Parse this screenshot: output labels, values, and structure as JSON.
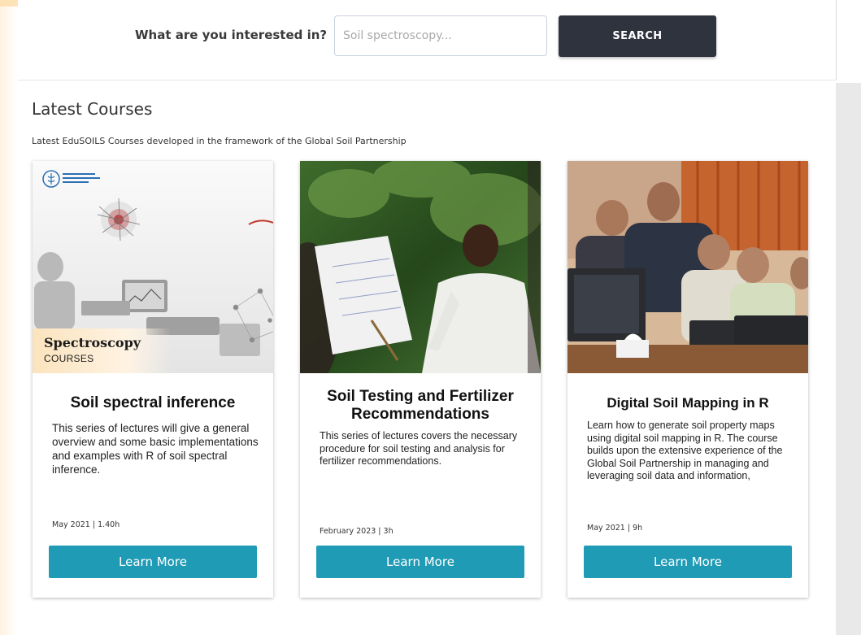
{
  "search": {
    "label": "What are you interested in?",
    "placeholder": "Soil spectroscopy...",
    "button_label": "SEARCH"
  },
  "section": {
    "title": "Latest Courses",
    "subtitle": "Latest EduSOILS Courses developed in the framework of the Global Soil Partnership"
  },
  "courses": [
    {
      "badge_title": "Spectroscopy",
      "badge_sub": "COURSES",
      "title": "Soil spectral inference",
      "description": "This series of lectures will give a general overview and some basic implementations and examples with R of soil spectral inference.",
      "meta": "May 2021 | 1.40h",
      "button_label": "Learn More"
    },
    {
      "title": "Soil Testing and Fertilizer Recommendations",
      "description": "This series of lectures covers the necessary procedure for soil testing and analysis for fertilizer recommendations.",
      "meta": "February 2023 | 3h",
      "button_label": "Learn More"
    },
    {
      "title": "Digital Soil Mapping in R",
      "description": "Learn how to generate soil property maps using digital soil mapping in R. The course builds upon the extensive experience of the Global Soil Partnership in managing and leveraging soil data and information,",
      "meta": "May 2021 | 9h",
      "button_label": "Learn More"
    }
  ],
  "colors": {
    "search_button": "#2e333d",
    "learn_button": "#1f9bb5",
    "accent_orange": "#fde2b6"
  }
}
